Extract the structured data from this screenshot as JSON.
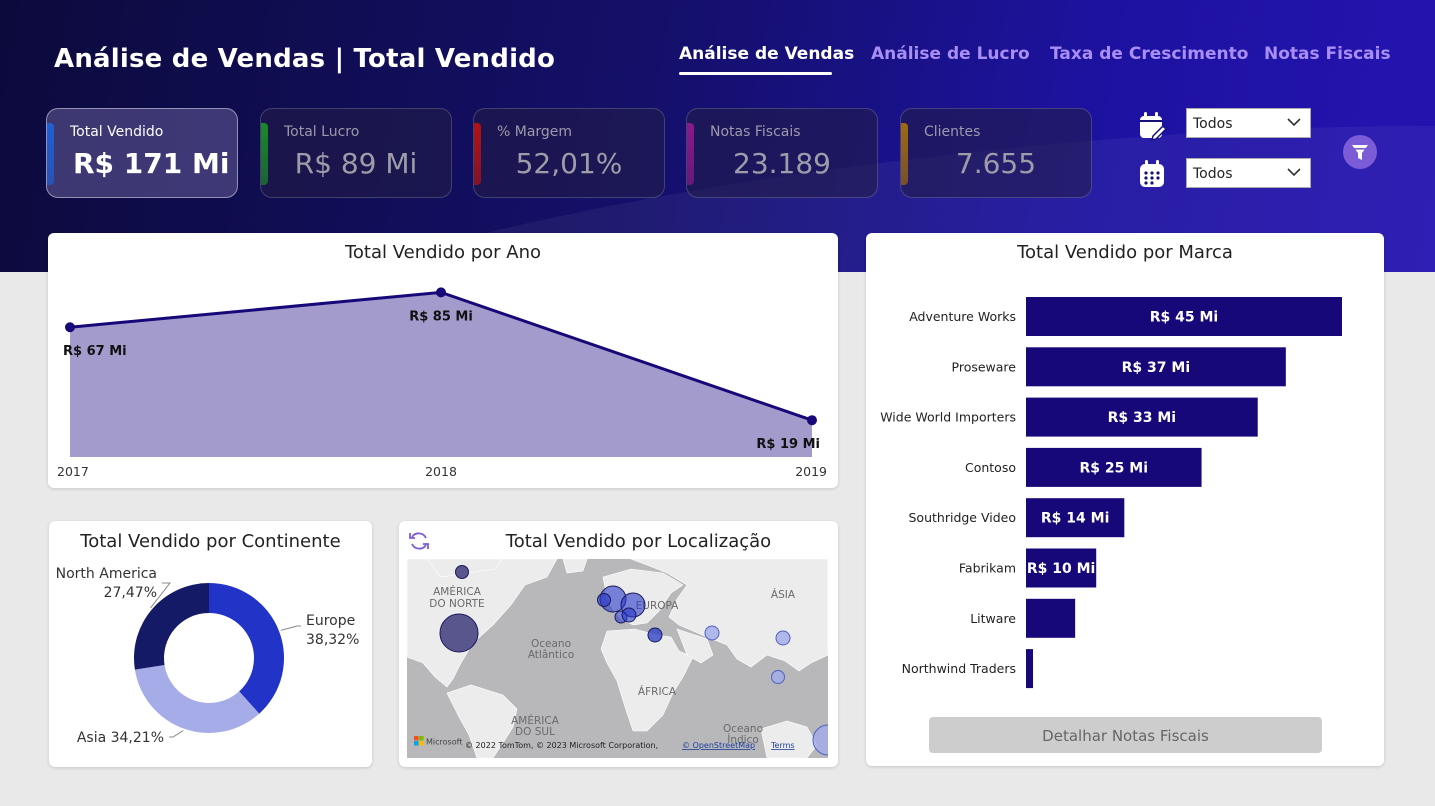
{
  "header": {
    "title": "Análise de Vendas | Total Vendido",
    "nav": [
      {
        "label": "Análise de Vendas",
        "active": true
      },
      {
        "label": "Análise de Lucro",
        "active": false
      },
      {
        "label": "Taxa de Crescimento",
        "active": false
      },
      {
        "label": "Notas Fiscais",
        "active": false
      }
    ]
  },
  "kpis": [
    {
      "label": "Total Vendido",
      "value": "R$ 171 Mi",
      "color": "#1f5fd6",
      "active": true
    },
    {
      "label": "Total Lucro",
      "value": "R$ 89 Mi",
      "color": "#1a8a2a",
      "active": false
    },
    {
      "label": "% Margem",
      "value": "52,01%",
      "color": "#b01414",
      "active": false
    },
    {
      "label": "Notas Fiscais",
      "value": "23.189",
      "color": "#8a1a8a",
      "active": false
    },
    {
      "label": "Clientes",
      "value": "7.655",
      "color": "#a06a10",
      "active": false
    }
  ],
  "slicers": [
    {
      "icon": "calendar-edit-icon",
      "value": "Todos"
    },
    {
      "icon": "calendar-grid-icon",
      "value": "Todos"
    }
  ],
  "colors": {
    "primary": "#17087a",
    "area": "#a29bcb",
    "accent": "#7b5cd6"
  },
  "year_chart": {
    "title": "Total Vendido por Ano",
    "chart_data": {
      "type": "area",
      "x": [
        "2017",
        "2018",
        "2019"
      ],
      "values": [
        67,
        85,
        19
      ],
      "labels": [
        "R$ 67 Mi",
        "R$ 85 Mi",
        "R$ 19 Mi"
      ]
    }
  },
  "brand_chart": {
    "title": "Total Vendido por Marca",
    "chart_data": {
      "type": "bar",
      "categories": [
        "Adventure Works",
        "Proseware",
        "Wide World Importers",
        "Contoso",
        "Southridge Video",
        "Fabrikam",
        "Litware",
        "Northwind Traders"
      ],
      "values": [
        45,
        37,
        33,
        25,
        14,
        10,
        7,
        1
      ],
      "labels": [
        "R$ 45 Mi",
        "R$ 37 Mi",
        "R$ 33 Mi",
        "R$ 25 Mi",
        "R$ 14 Mi",
        "R$ 10 Mi",
        "",
        ""
      ]
    }
  },
  "continent_chart": {
    "title": "Total Vendido por Continente",
    "chart_data": {
      "type": "pie",
      "categories": [
        "Europe",
        "Asia",
        "North America"
      ],
      "values": [
        38.32,
        34.21,
        27.47
      ],
      "labels": [
        "38,32%",
        "34,21%",
        "27,47%"
      ],
      "colors": [
        "#2233c8",
        "#a6ace8",
        "#141a66"
      ]
    }
  },
  "map_chart": {
    "title": "Total Vendido por Localização",
    "labels": {
      "na": [
        "AMÉRICA",
        "DO NORTE"
      ],
      "ocean_atl": [
        "Oceano",
        "Atlântico"
      ],
      "europe": "EUROPA",
      "asia": "ÁSIA",
      "africa": "ÁFRICA",
      "sa": [
        "AMÉRICA",
        "DO SUL"
      ],
      "ocean_ind": [
        "Oceano",
        "Índico"
      ]
    },
    "attribution": "© 2022 TomTom, © 2023 Microsoft Corporation,",
    "osm_link": "© OpenStreetMap",
    "terms_link": "Terms",
    "ms_logo": "Microsoft"
  },
  "detail_button": "Detalhar Notas Fiscais"
}
